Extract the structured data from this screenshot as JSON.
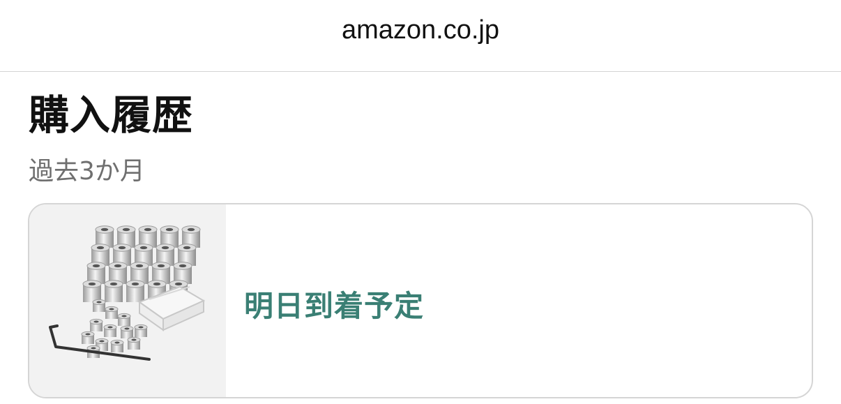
{
  "header": {
    "url": "amazon.co.jp"
  },
  "page": {
    "title": "購入履歴",
    "period": "過去3か月"
  },
  "orders": [
    {
      "status": "明日到着予定",
      "status_color": "#3a7f74",
      "image": "metal-spacers-product-icon"
    }
  ]
}
